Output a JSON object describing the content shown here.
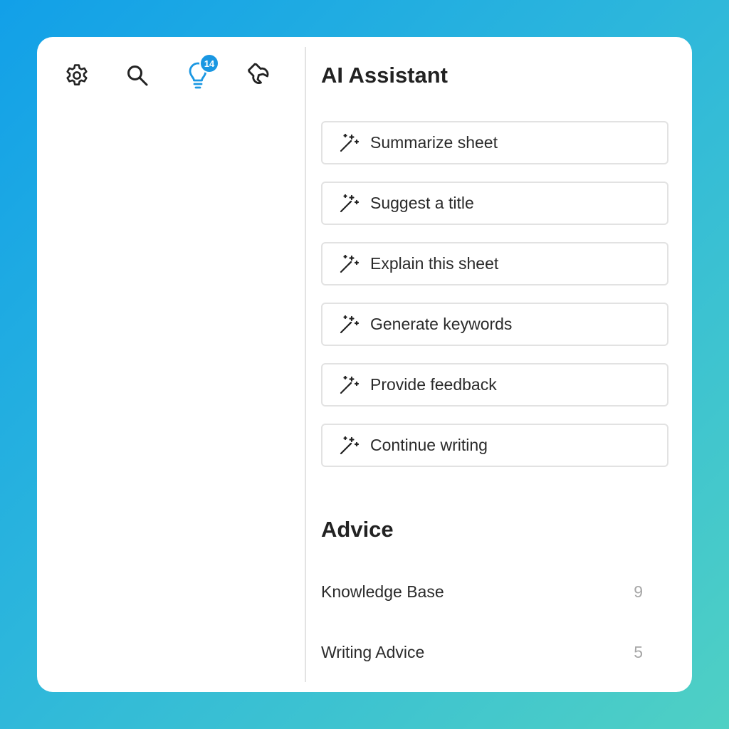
{
  "toolbar": {
    "icons": [
      {
        "name": "gear-icon",
        "color": "#222222"
      },
      {
        "name": "search-icon",
        "color": "#222222"
      },
      {
        "name": "lightbulb-icon",
        "color": "#1a97e2"
      },
      {
        "name": "wrench-icon",
        "color": "#222222"
      }
    ],
    "ideas_badge": "14"
  },
  "assistant": {
    "title": "AI Assistant",
    "action_icon": "magic-wand-icon",
    "actions": [
      {
        "label": "Summarize sheet"
      },
      {
        "label": "Suggest a title"
      },
      {
        "label": "Explain this sheet"
      },
      {
        "label": "Generate keywords"
      },
      {
        "label": "Provide feedback"
      },
      {
        "label": "Continue writing"
      }
    ]
  },
  "advice": {
    "title": "Advice",
    "items": [
      {
        "label": "Knowledge Base",
        "count": "9"
      },
      {
        "label": "Writing Advice",
        "count": "5"
      }
    ]
  },
  "colors": {
    "accent": "#1a97e2",
    "background_gradient": [
      "#12a0e8",
      "#4fd0c4"
    ],
    "card": "#ffffff",
    "border": "#e2e2e2"
  }
}
